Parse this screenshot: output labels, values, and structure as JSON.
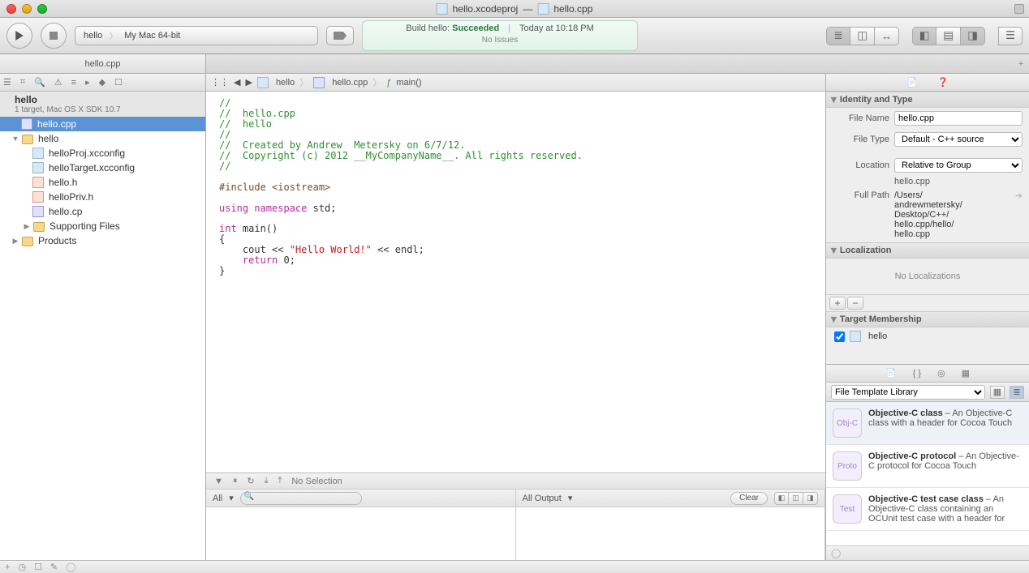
{
  "title": {
    "project": "hello.xcodeproj",
    "sep": "—",
    "file": "hello.cpp"
  },
  "toolbar": {
    "scheme_target": "hello",
    "scheme_dest": "My Mac 64-bit",
    "activity_prefix": "Build hello:",
    "activity_status": "Succeeded",
    "activity_time": "Today at 10:18 PM",
    "activity_sub": "No Issues"
  },
  "tabbar": {
    "tab1": "hello.cpp"
  },
  "navigator": {
    "project_name": "hello",
    "project_sub": "1 target, Mac OS X SDK 10.7",
    "items": [
      "hello.cpp",
      "hello",
      "helloProj.xcconfig",
      "helloTarget.xcconfig",
      "hello.h",
      "helloPriv.h",
      "hello.cp",
      "Supporting Files",
      "Products"
    ]
  },
  "jumpbar": {
    "p1": "hello",
    "p2": "hello.cpp",
    "p3": "main()"
  },
  "code": {
    "c1": "//",
    "c2": "//  hello.cpp",
    "c3": "//  hello",
    "c4": "//",
    "c5": "//  Created by Andrew  Metersky on 6/7/12.",
    "c6": "//  Copyright (c) 2012 __MyCompanyName__. All rights reserved.",
    "c7": "//",
    "inc": "#include <iostream>",
    "using_kw": "using namespace",
    "using_ns": " std;",
    "int_kw": "int",
    "main_sig": " main()",
    "brace_o": "{",
    "cout": "    cout << ",
    "str": "\"Hello World!\"",
    "endl": " << endl;",
    "ret_kw": "    return",
    "ret": " 0;",
    "brace_c": "}"
  },
  "debug": {
    "no_sel": "No Selection",
    "all": "All",
    "all_output": "All Output",
    "clear": "Clear"
  },
  "inspector": {
    "identity_title": "Identity and Type",
    "file_name_label": "File Name",
    "file_name": "hello.cpp",
    "file_type_label": "File Type",
    "file_type": "Default - C++ source",
    "location_label": "Location",
    "location": "Relative to Group",
    "location_sub": "hello.cpp",
    "full_path_label": "Full Path",
    "full_path": "/Users/\nandrewmetersky/\nDesktop/C++/\nhello.cpp/hello/\nhello.cpp",
    "localization_title": "Localization",
    "no_loc": "No Localizations",
    "target_title": "Target Membership",
    "target": "hello",
    "library_select": "File Template Library",
    "lib_items": [
      {
        "title": "Objective-C class",
        "desc": " – An Objective-C class with a header for Cocoa Touch",
        "tag": "Obj-C"
      },
      {
        "title": "Objective-C protocol",
        "desc": " – An Objective-C protocol for Cocoa Touch",
        "tag": "Proto"
      },
      {
        "title": "Objective-C test case class",
        "desc": " – An Objective-C class containing an OCUnit test case with a header for",
        "tag": "Test"
      }
    ]
  }
}
